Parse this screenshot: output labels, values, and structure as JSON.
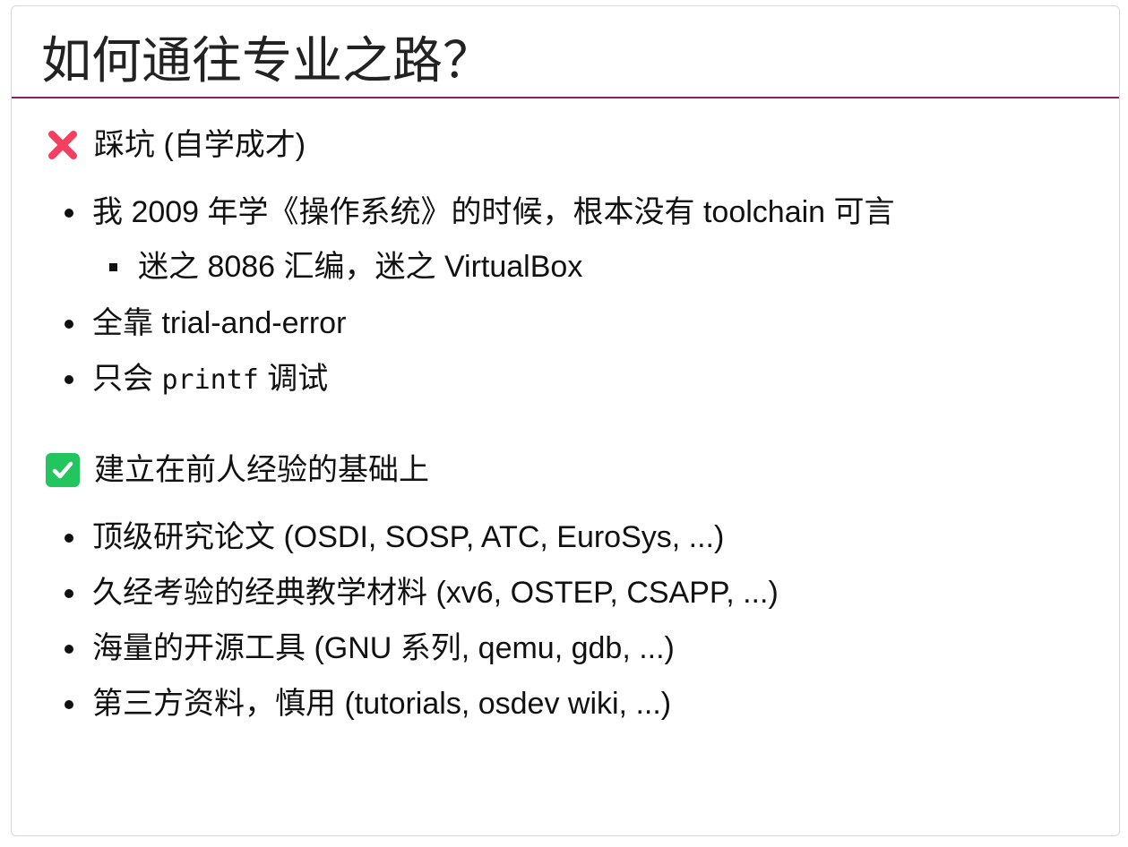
{
  "slide": {
    "title": "如何通往专业之路？",
    "sections": [
      {
        "icon": "cross-mark-icon",
        "icon_color": "#f43f5e",
        "heading": "踩坑 (自学成才)",
        "items": [
          {
            "text": "我 2009 年学《操作系统》的时候，根本没有 toolchain 可言"
          },
          {
            "text": "迷之 8086 汇编，迷之 VirtualBox"
          },
          {
            "text": "全靠 trial-and-error"
          },
          {
            "prefix": "只会 ",
            "code": "printf",
            "suffix": " 调试"
          }
        ]
      },
      {
        "icon": "check-mark-icon",
        "icon_color": "#22c55e",
        "heading": "建立在前人经验的基础上",
        "items": [
          {
            "text": "顶级研究论文 (OSDI, SOSP, ATC, EuroSys, ...)"
          },
          {
            "text": "久经考验的经典教学材料 (xv6, OSTEP, CSAPP, ...)"
          },
          {
            "text": "海量的开源工具 (GNU 系列, qemu, gdb, ...)"
          },
          {
            "text": "第三方资料，慎用 (tutorials, osdev wiki, ...)"
          }
        ]
      }
    ],
    "accent_color": "#8a1f6e"
  }
}
